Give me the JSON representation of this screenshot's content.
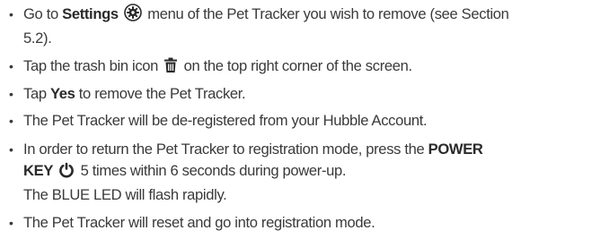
{
  "bullet_glyph": "•",
  "items": [
    {
      "pre": "Go to ",
      "bold": "Settings",
      "icon": "gear-icon",
      "post": " menu of the Pet Tracker you wish to remove (see Section",
      "line2": "5.2)."
    },
    {
      "pre": "Tap the trash bin icon ",
      "icon": "trash-icon",
      "post": " on the top right corner of the screen."
    },
    {
      "pre": "Tap ",
      "bold": "Yes",
      "post": " to remove the Pet Tracker."
    },
    {
      "text": "The Pet Tracker will be de-registered from your Hubble Account."
    },
    {
      "pre": "In order to return the Pet Tracker to registration mode, press the ",
      "bold": "POWER",
      "line2_bold": "KEY",
      "icon": "power-icon",
      "line2_post": " 5 times within 6 seconds during power-up.",
      "line3": "The BLUE LED will flash rapidly."
    },
    {
      "text": "The Pet Tracker will reset and go into registration mode."
    }
  ]
}
